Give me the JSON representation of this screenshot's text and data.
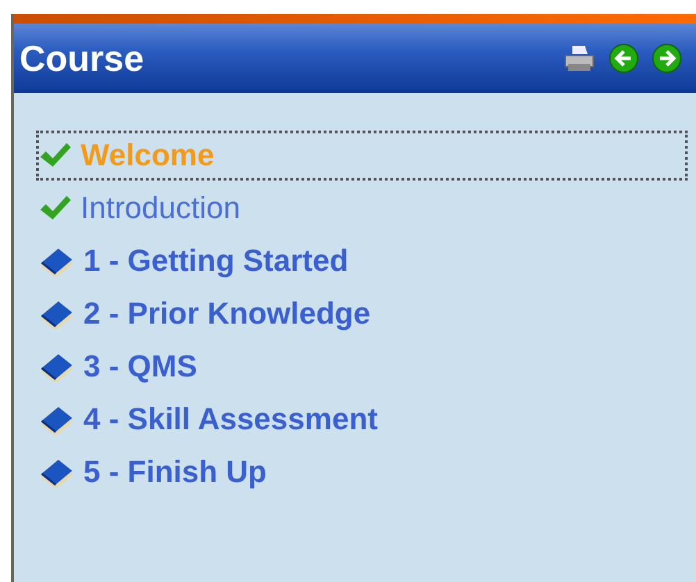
{
  "panel": {
    "title": "Course"
  },
  "toolbar": [
    {
      "kind": "print"
    },
    {
      "kind": "back"
    },
    {
      "kind": "forward"
    }
  ],
  "items": [
    {
      "label": "Welcome",
      "kind": "done",
      "selected": true
    },
    {
      "label": "Introduction",
      "kind": "done",
      "selected": false
    },
    {
      "label": "1 - Getting Started",
      "kind": "chapter",
      "selected": false
    },
    {
      "label": "2 - Prior Knowledge",
      "kind": "chapter",
      "selected": false
    },
    {
      "label": "3 - QMS",
      "kind": "chapter",
      "selected": false
    },
    {
      "label": "4 - Skill Assessment",
      "kind": "chapter",
      "selected": false
    },
    {
      "label": "5 - Finish Up",
      "kind": "chapter",
      "selected": false
    }
  ]
}
